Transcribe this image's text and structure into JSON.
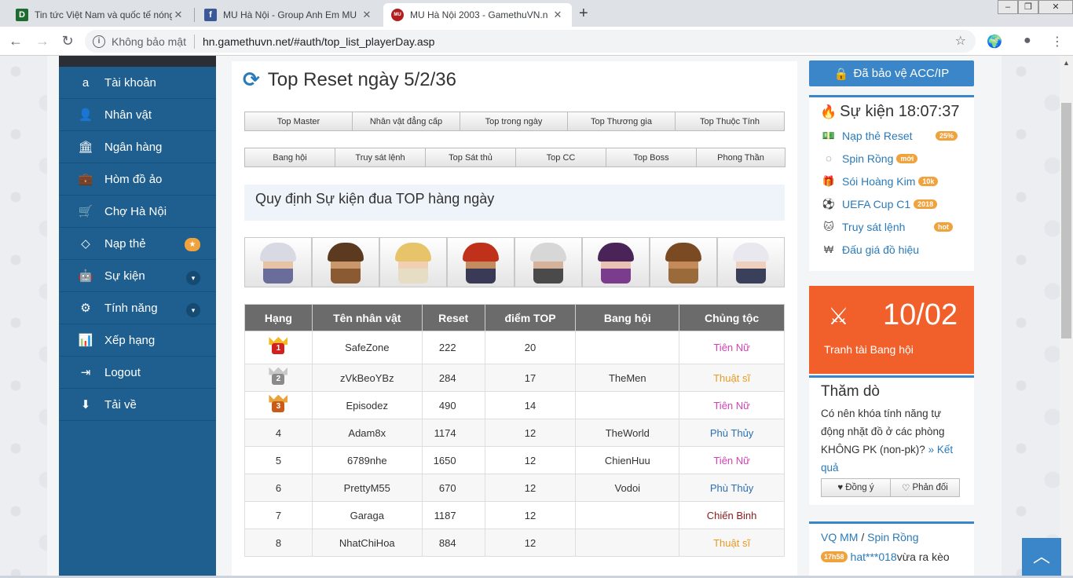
{
  "browser": {
    "tabs": [
      {
        "title": "Tin tức Việt Nam và quốc tế nóng",
        "favicon": "D"
      },
      {
        "title": "MU Hà Nội - Group Anh Em MU",
        "favicon": "f"
      },
      {
        "title": "MU Hà Nội 2003 - GamethuVN.n",
        "favicon": "MU"
      }
    ],
    "security_label": "Không bảo mật",
    "url": "hn.gamethuvn.net/#auth/top_list_playerDay.asp"
  },
  "sidebar": {
    "items": [
      {
        "label": "Tài khoản",
        "icon": "amazon-icon"
      },
      {
        "label": "Nhân vật",
        "icon": "user-icon"
      },
      {
        "label": "Ngân hàng",
        "icon": "bank-icon"
      },
      {
        "label": "Hòm đồ ảo",
        "icon": "briefcase-icon"
      },
      {
        "label": "Chợ Hà Nội",
        "icon": "cart-icon"
      },
      {
        "label": "Nạp thẻ",
        "icon": "diamond-icon"
      },
      {
        "label": "Sự kiện",
        "icon": "android-icon"
      },
      {
        "label": "Tính năng",
        "icon": "gears-icon"
      },
      {
        "label": "Xếp hạng",
        "icon": "bar-chart-icon"
      },
      {
        "label": "Logout",
        "icon": "sign-out-icon"
      },
      {
        "label": "Tải về",
        "icon": "download-icon"
      }
    ]
  },
  "main": {
    "title": "Top Reset ngày 5/2/36",
    "tabs_row1": [
      "Top Master",
      "Nhân vật đẳng cấp",
      "Top trong ngày",
      "Top Thương gia",
      "Top Thuộc Tính"
    ],
    "tabs_row2": [
      "Bang hội",
      "Truy sát lệnh",
      "Top Sát thủ",
      "Top CC",
      "Top Boss",
      "Phong Thần"
    ],
    "rules_title": "Quy định Sự kiện đua TOP hàng ngày",
    "characters": [
      {
        "hair": "#d9d9e3",
        "skin": "#e6c3a5",
        "armor": "#6a6c9a"
      },
      {
        "hair": "#5b3a1f",
        "skin": "#c99769",
        "armor": "#8a5a32"
      },
      {
        "hair": "#e7c46a",
        "skin": "#f1cfb3",
        "armor": "#e7dcc4"
      },
      {
        "hair": "#c0311c",
        "skin": "#c48a60",
        "armor": "#3b3a56"
      },
      {
        "hair": "#d7d7d7",
        "skin": "#d5b299",
        "armor": "#4a4a4a"
      },
      {
        "hair": "#4a2458",
        "skin": "#e9c2b4",
        "armor": "#7b3c8e"
      },
      {
        "hair": "#7a4b22",
        "skin": "#c58a5a",
        "armor": "#9a6a3a"
      },
      {
        "hair": "#e8e8ee",
        "skin": "#efcfbd",
        "armor": "#3a3f5a"
      }
    ],
    "table": {
      "headers": [
        "Hạng",
        "Tên nhân vật",
        "Reset",
        "điểm TOP",
        "Bang hội",
        "Chủng tộc"
      ],
      "rows": [
        {
          "rank": "1",
          "medal": "gold",
          "name": "SafeZone",
          "reset": "222",
          "top": "20",
          "guild": "",
          "race": "Tiên Nữ",
          "race_color": "#d243b6"
        },
        {
          "rank": "2",
          "medal": "silver",
          "name": "zVkBeoYBz",
          "reset": "284",
          "top": "17",
          "guild": "TheMen",
          "race": "Thuật sĩ",
          "race_color": "#e89a22"
        },
        {
          "rank": "3",
          "medal": "bronze",
          "name": "Episodez",
          "reset": "490",
          "top": "14",
          "guild": "",
          "race": "Tiên Nữ",
          "race_color": "#d243b6"
        },
        {
          "rank": "4",
          "medal": "",
          "name": "Adam8x",
          "reset": "1174",
          "top": "12",
          "guild": "TheWorld",
          "race": "Phù Thủy",
          "race_color": "#2a6fb5"
        },
        {
          "rank": "5",
          "medal": "",
          "name": "6789nhe",
          "reset": "1650",
          "top": "12",
          "guild": "ChienHuu",
          "race": "Tiên Nữ",
          "race_color": "#d243b6"
        },
        {
          "rank": "6",
          "medal": "",
          "name": "PrettyM55",
          "reset": "670",
          "top": "12",
          "guild": "Vodoi",
          "race": "Phù Thủy",
          "race_color": "#2a6fb5"
        },
        {
          "rank": "7",
          "medal": "",
          "name": "Garaga",
          "reset": "1187",
          "top": "12",
          "guild": "",
          "race": "Chiến Binh",
          "race_color": "#8b1a1a"
        },
        {
          "rank": "8",
          "medal": "",
          "name": "NhatChiHoa",
          "reset": "884",
          "top": "12",
          "guild": "",
          "race": "Thuật sĩ",
          "race_color": "#e89a22"
        }
      ]
    }
  },
  "right": {
    "protect_label": "Đã bảo vệ ACC/IP",
    "events_title": "Sự kiện 18:07:37",
    "events": [
      {
        "label": "Nạp thẻ Reset",
        "tag": "25%",
        "icon": "money-icon"
      },
      {
        "label": "Spin Rồng",
        "tag": "mới",
        "icon": "spinner-icon"
      },
      {
        "label": "Sói Hoàng Kim",
        "tag": "10k",
        "icon": "gift-icon"
      },
      {
        "label": "UEFA Cup C1",
        "tag": "2018",
        "icon": "soccer-ball-icon"
      },
      {
        "label": "Truy sát lệnh",
        "tag": "hot",
        "icon": "github-icon"
      },
      {
        "label": "Đấu giá đồ hiệu",
        "tag": "",
        "icon": "won-icon"
      }
    ],
    "clan_date": "10/02",
    "clan_label": "Tranh tài Bang hội",
    "poll": {
      "title": "Thăm dò",
      "question": "Có nên khóa tính năng tự động nhặt đồ ở các phòng KHÔNG PK (non-pk)?",
      "result_link": "» Kết quả",
      "agree": "Đồng ý",
      "disagree": "Phản đối"
    },
    "spin": {
      "vq": "VQ MM",
      "sep": " / ",
      "spin_link": "Spin Rồng",
      "time_tag": "17h58",
      "user": "hat***018",
      "text": " vừa ra kèo"
    }
  }
}
